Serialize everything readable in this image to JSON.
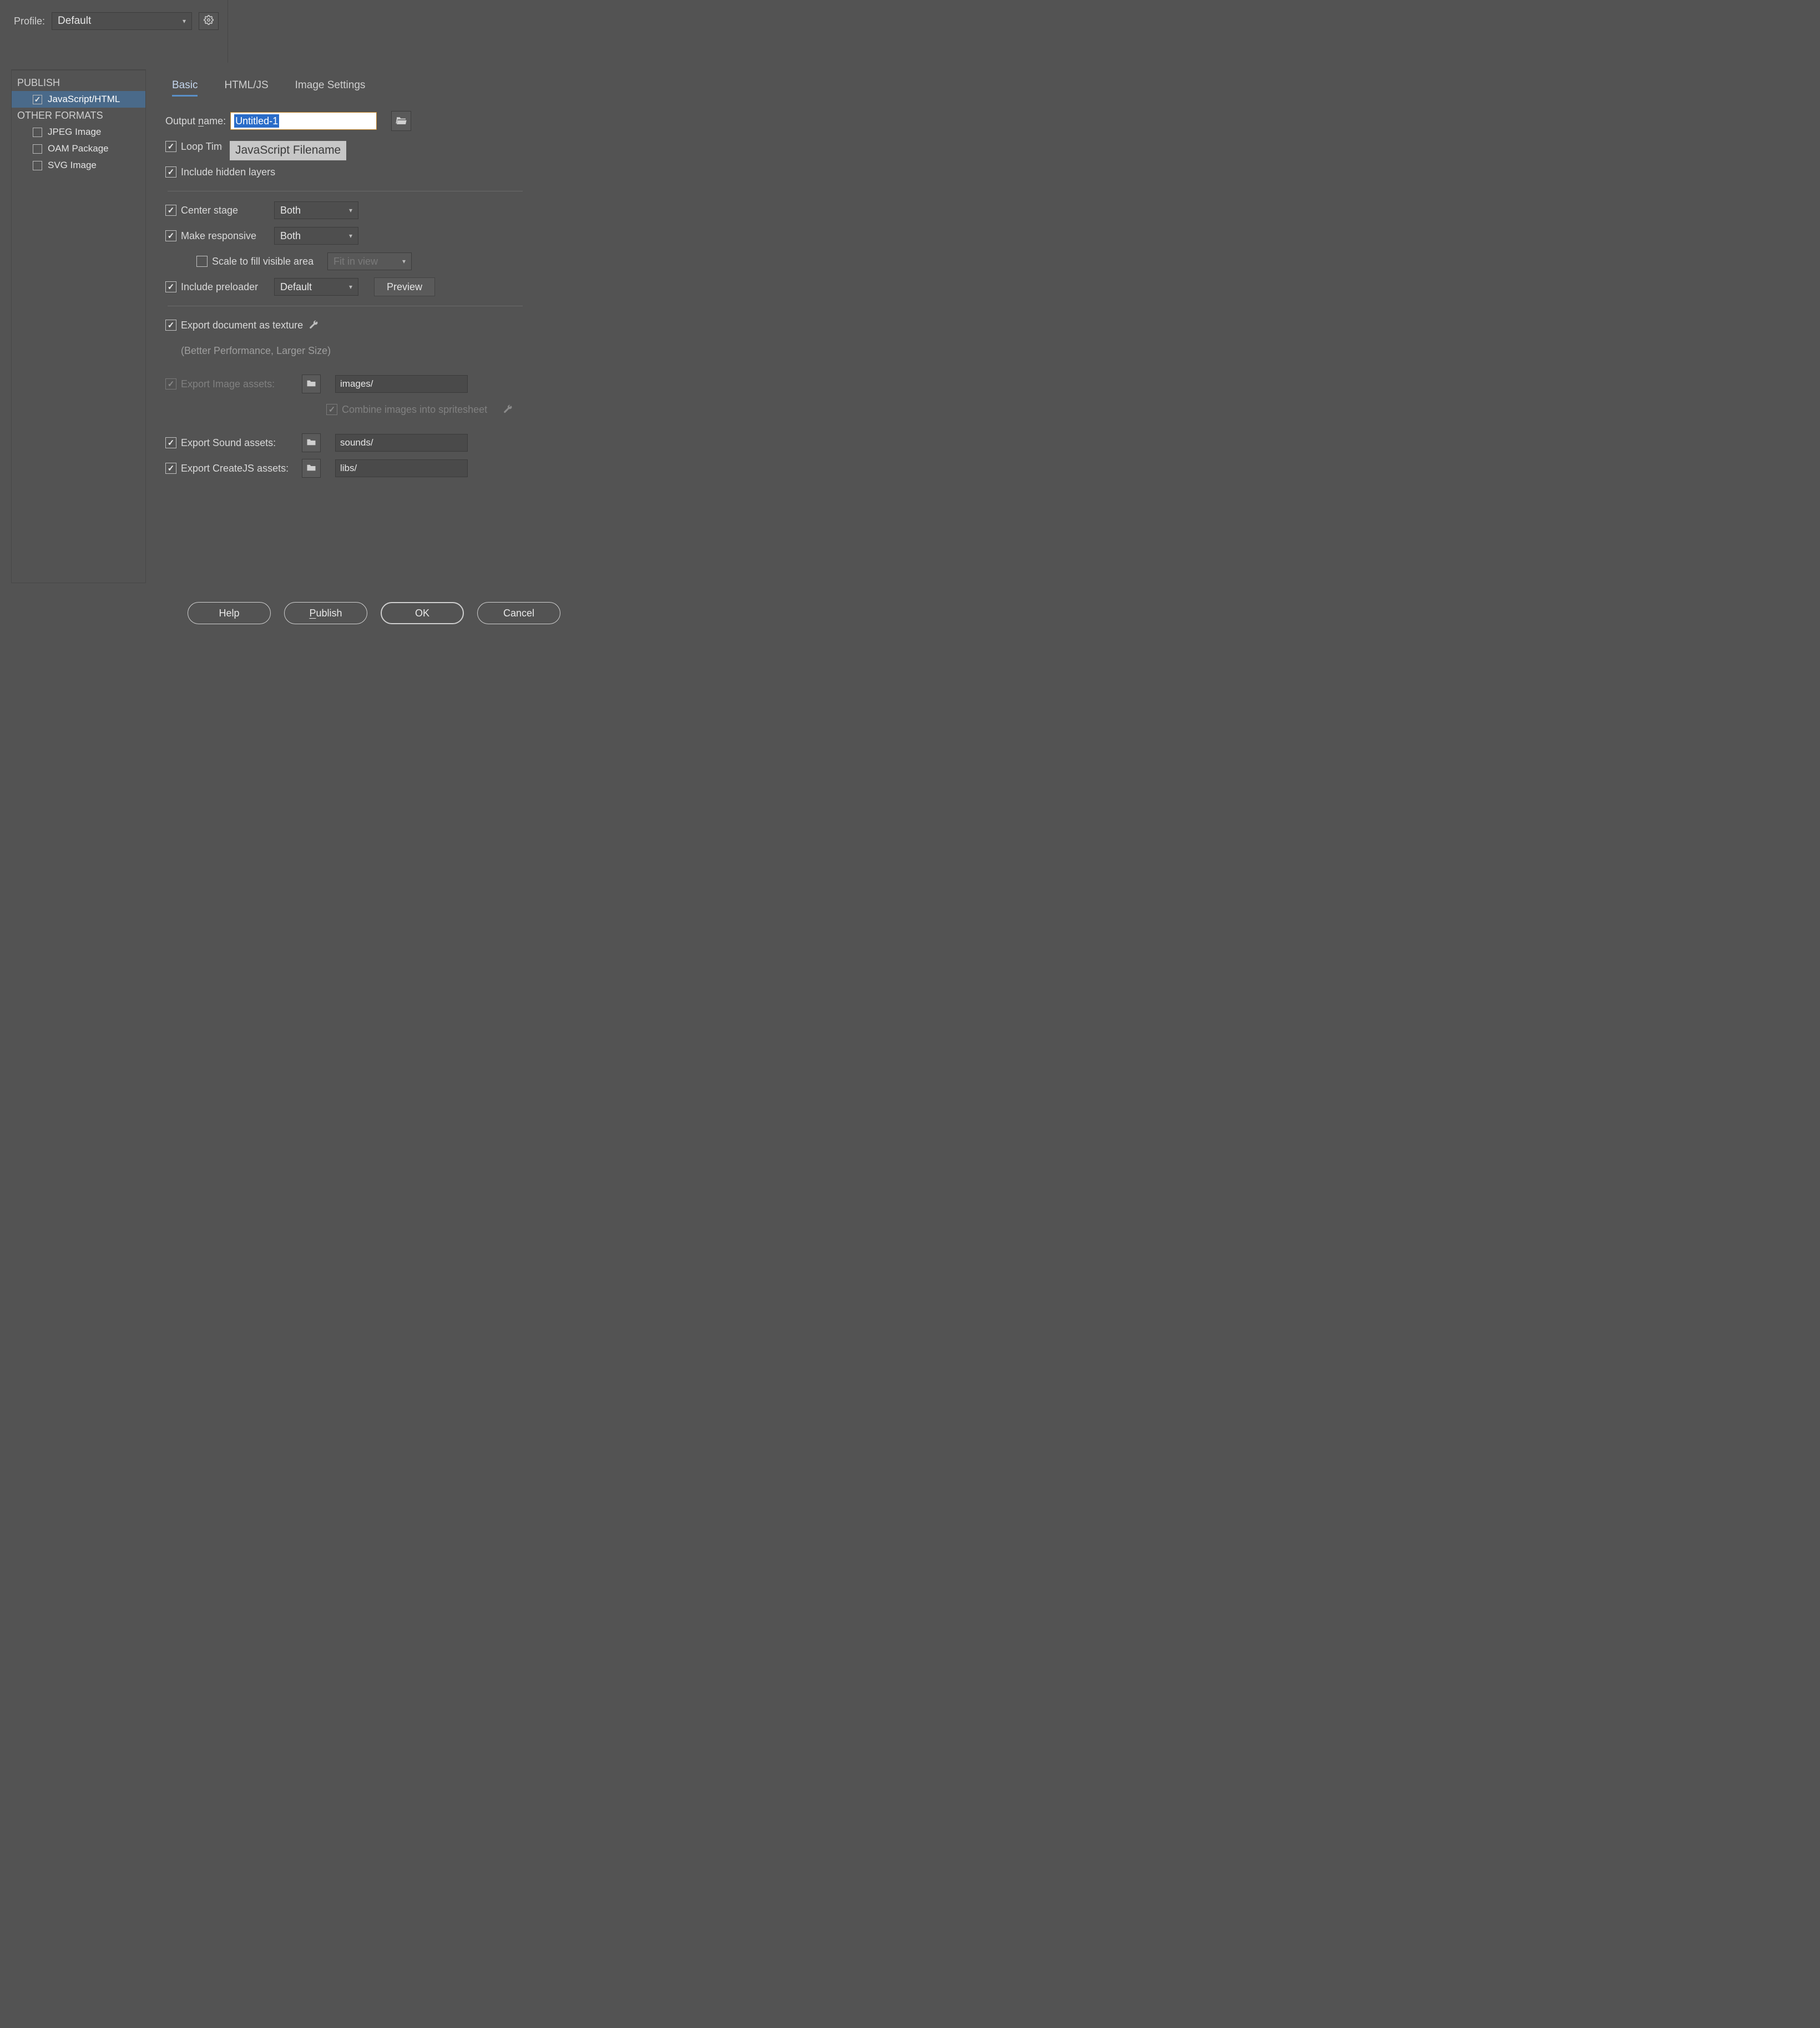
{
  "profile": {
    "label": "Profile:",
    "selected": "Default"
  },
  "sidebar": {
    "header_publish": "PUBLISH",
    "header_other": "OTHER FORMATS",
    "items": [
      {
        "label": "JavaScript/HTML",
        "checked": true,
        "selected": true
      },
      {
        "label": "JPEG Image",
        "checked": false,
        "selected": false
      },
      {
        "label": "OAM Package",
        "checked": false,
        "selected": false
      },
      {
        "label": "SVG Image",
        "checked": false,
        "selected": false
      }
    ]
  },
  "tabs": {
    "basic": "Basic",
    "htmljs": "HTML/JS",
    "image": "Image Settings"
  },
  "basic": {
    "output_label_pre": "Output",
    "output_label_u": "n",
    "output_label_post": "ame:",
    "output_value": "Untitled-1",
    "tooltip": "JavaScript Filename",
    "loop_timeline": "Loop Timeline",
    "include_hidden": "Include hidden layers",
    "center_stage": {
      "label": "Center stage",
      "value": "Both"
    },
    "make_responsive": {
      "label": "Make responsive",
      "value": "Both"
    },
    "scale_fill": {
      "label": "Scale to fill visible area",
      "value": "Fit in view"
    },
    "include_preloader": {
      "label": "Include preloader",
      "value": "Default",
      "btn": "Preview"
    },
    "export_texture": {
      "label": "Export document as texture",
      "hint": "(Better Performance, Larger Size)"
    },
    "export_images": {
      "label": "Export Image assets:",
      "path": "images/"
    },
    "combine_spritesheet": "Combine images into spritesheet",
    "export_sound": {
      "label": "Export Sound assets:",
      "path": "sounds/"
    },
    "export_createjs": {
      "label": "Export CreateJS assets:",
      "path": "libs/"
    }
  },
  "buttons": {
    "help": "Help",
    "publish_pre": "",
    "publish_u": "P",
    "publish_post": "ublish",
    "ok": "OK",
    "cancel": "Cancel"
  }
}
